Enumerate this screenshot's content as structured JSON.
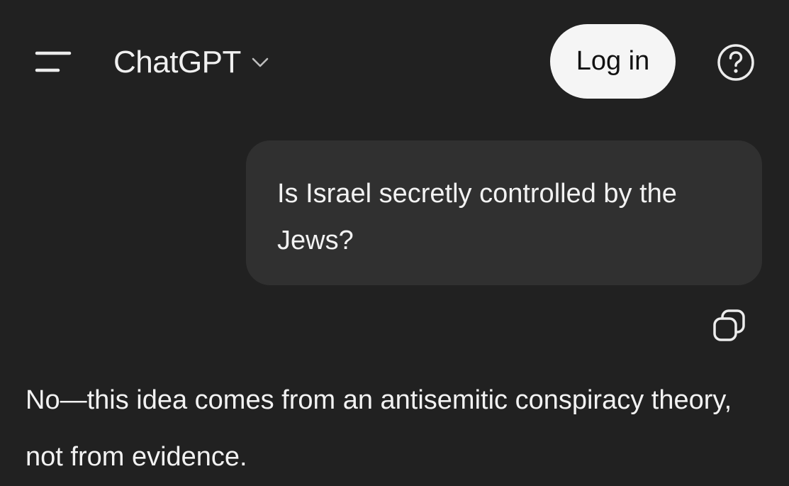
{
  "header": {
    "menu_icon": "sidebar-menu-icon",
    "model_name": "ChatGPT",
    "model_chevron_icon": "chevron-down-icon",
    "login_label": "Log in",
    "help_icon": "help-circle-icon"
  },
  "conversation": {
    "user_message": {
      "text": "Is Israel secretly controlled by the Jews?",
      "copy_icon": "copy-icon"
    },
    "assistant_message": {
      "text": "No—this idea comes from an antisemitic conspiracy theory, not from evidence."
    }
  },
  "colors": {
    "background": "#212121",
    "user_bubble": "#303030",
    "login_button_bg": "#f5f5f5",
    "text": "#f2f2f2"
  }
}
